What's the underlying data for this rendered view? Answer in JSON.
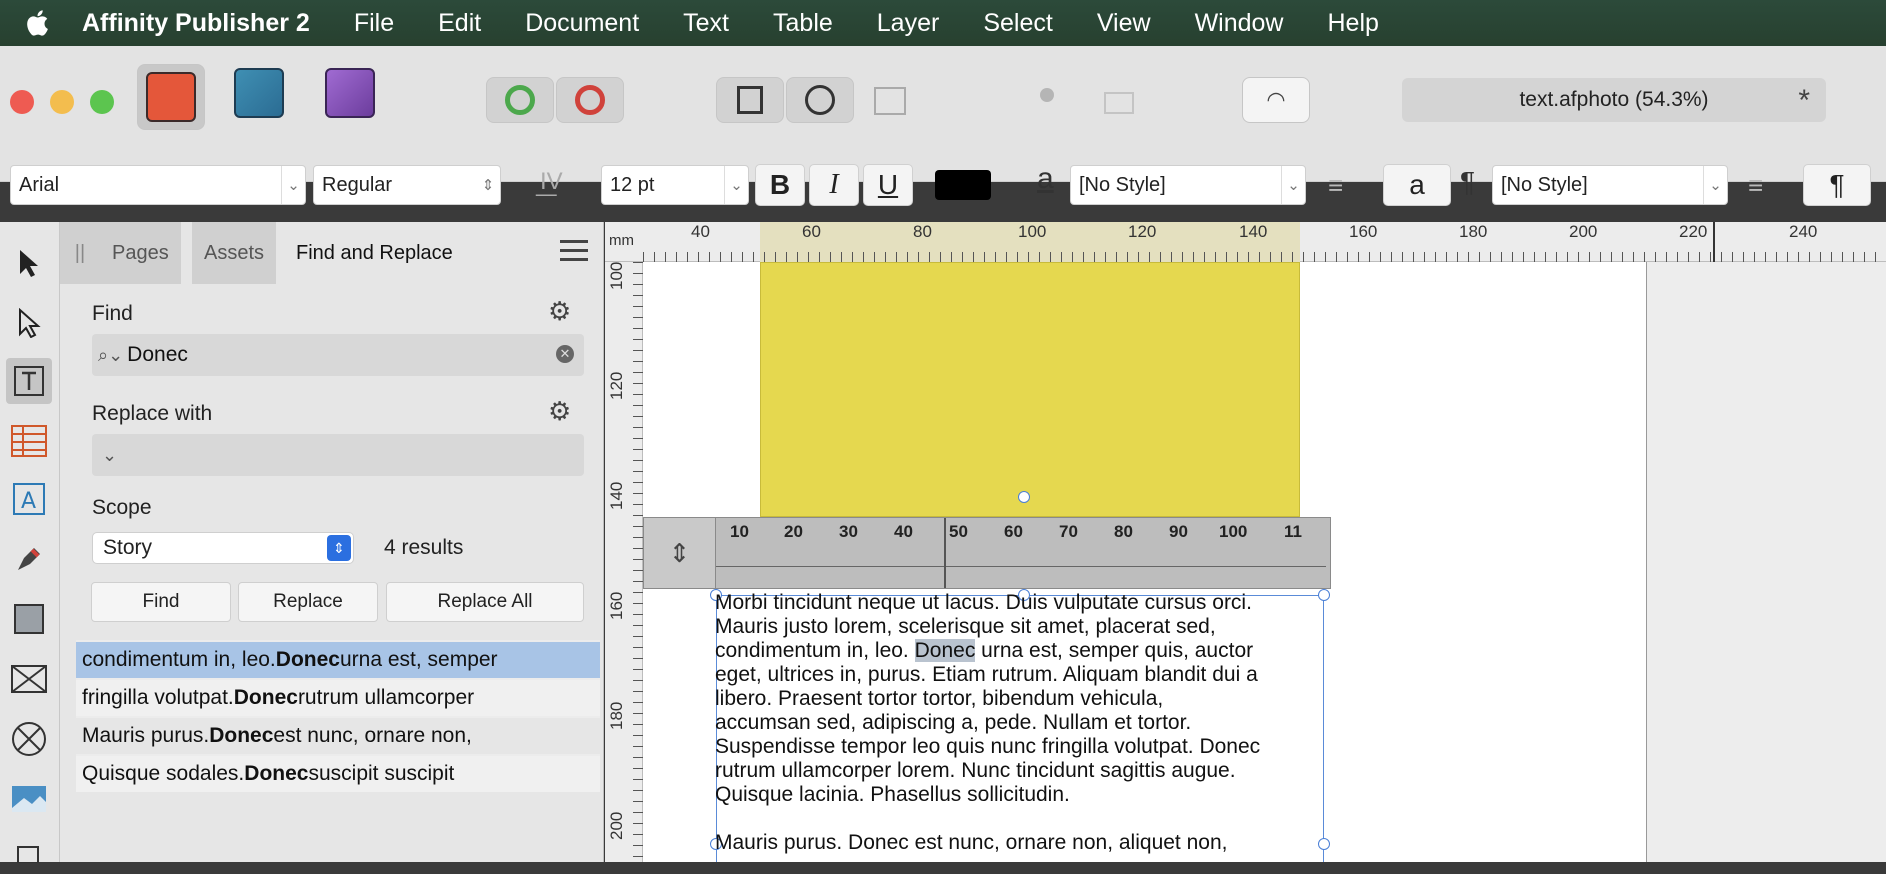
{
  "menubar": {
    "app": "Affinity Publisher 2",
    "items": [
      "File",
      "Edit",
      "Document",
      "Text",
      "Table",
      "Layer",
      "Select",
      "View",
      "Window",
      "Help"
    ]
  },
  "toolbar": {
    "document_tab": "text.afphoto (54.3%)",
    "modified_marker": "*"
  },
  "context": {
    "font": "Arial",
    "style": "Regular",
    "size": "12 pt",
    "bold": "B",
    "italic": "I",
    "underline": "U",
    "char_style": "[No Style]",
    "para_style": "[No Style]",
    "char_glyph": "a",
    "para_glyph": "¶"
  },
  "panel": {
    "tabs": [
      "Pages",
      "Assets",
      "Find and Replace"
    ],
    "find_label": "Find",
    "find_value": "Donec",
    "replace_label": "Replace with",
    "scope_label": "Scope",
    "scope_value": "Story",
    "results_count": "4 results",
    "buttons": {
      "find": "Find",
      "replace": "Replace",
      "replace_all": "Replace All"
    },
    "results": [
      {
        "pre": "condimentum in, leo. ",
        "match": "Donec",
        "post": " urna est, semper",
        "selected": true
      },
      {
        "pre": "fringilla volutpat. ",
        "match": "Donec",
        "post": " rutrum ullamcorper",
        "selected": false
      },
      {
        "pre": "Mauris purus. ",
        "match": "Donec",
        "post": " est nunc, ornare non,",
        "selected": false
      },
      {
        "pre": "Quisque sodales. ",
        "match": "Donec",
        "post": " suscipit suscipit",
        "selected": false
      }
    ]
  },
  "canvas": {
    "unit": "mm",
    "hruler_labels": [
      "40",
      "60",
      "80",
      "100",
      "120",
      "140",
      "160",
      "180",
      "200",
      "220",
      "240"
    ],
    "vruler_labels": [
      "100",
      "120",
      "140",
      "160",
      "180",
      "200"
    ],
    "text_ruler_labels": [
      "10",
      "20",
      "30",
      "40",
      "50",
      "60",
      "70",
      "80",
      "90",
      "100",
      "11"
    ],
    "text_lines": [
      "Morbi tincidunt neque ut lacus. Duis vulputate cursus orci.",
      "Mauris justo lorem, scelerisque sit amet, placerat sed,",
      "condimentum in, leo. ",
      "Donec",
      " urna est, semper quis, auctor",
      "eget, ultrices in, purus. Etiam rutrum. Aliquam blandit dui a",
      "libero. Praesent tortor tortor, bibendum vehicula,",
      "accumsan sed, adipiscing a, pede. Nullam et tortor.",
      "Suspendisse tempor leo quis nunc fringilla volutpat. Donec",
      "rutrum ullamcorper lorem. Nunc tincidunt sagittis augue.",
      "Quisque lacinia. Phasellus sollicitudin.",
      "Mauris purus. Donec est nunc, ornare non, aliquet non,"
    ]
  },
  "colors": {
    "yellow_shape": "#e5d84f",
    "selection": "#a8c4e6",
    "frame": "#4a7fd6"
  }
}
